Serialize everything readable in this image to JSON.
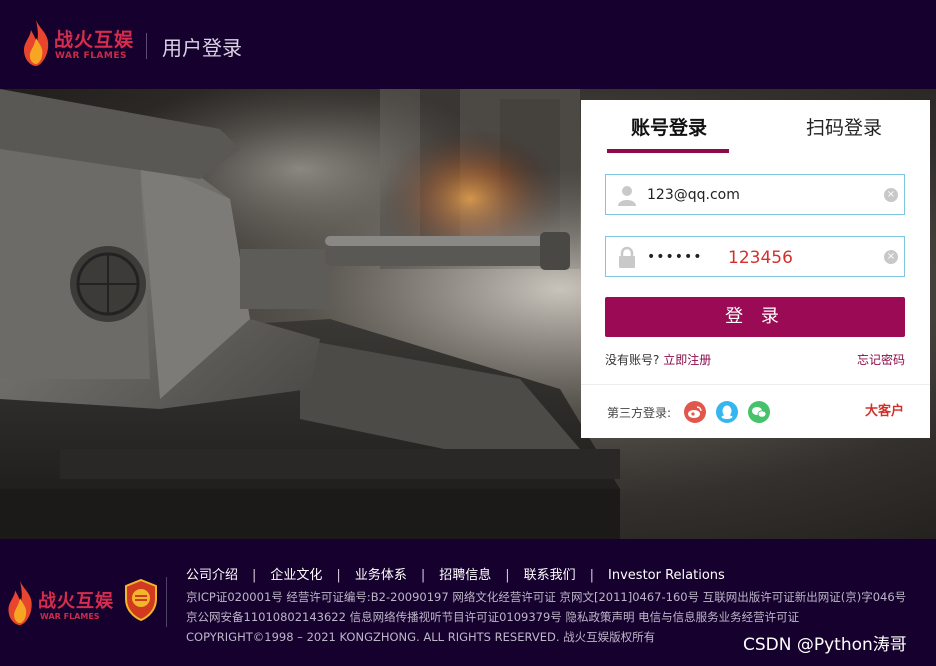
{
  "header": {
    "brand_cn": "战火互娱",
    "brand_en": "WAR FLAMES",
    "page_title": "用户登录"
  },
  "login": {
    "tabs": [
      {
        "label": "账号登录",
        "active": true
      },
      {
        "label": "扫码登录",
        "active": false
      }
    ],
    "username": {
      "value": "123@qq.com",
      "icon": "user-icon"
    },
    "password": {
      "masked_value": "••••••",
      "hint": "123456",
      "icon": "lock-icon"
    },
    "clear_glyph": "×",
    "submit_label": "登 录",
    "no_account_text": "没有账号?",
    "register_link": "立即注册",
    "forgot_link": "忘记密码",
    "third_party_label": "第三方登录:",
    "third_party": [
      "weibo-icon",
      "qq-icon",
      "wechat-icon"
    ],
    "vip_link": "大客户"
  },
  "footer": {
    "brand_cn": "战火互娱",
    "brand_en": "WAR FLAMES",
    "nav": [
      "公司介绍",
      "企业文化",
      "业务体系",
      "招聘信息",
      "联系我们",
      "Investor Relations"
    ],
    "nav_separator": "|",
    "line1": "京ICP证020001号   经营许可证编号:B2-20090197   网络文化经营许可证 京网文[2011]0467-160号   互联网出版许可证新出网证(京)字046号",
    "line2": "京公网安备11010802143622   信息网络传播视听节目许可证0109379号   隐私政策声明   电信与信息服务业务经营许可证",
    "line3": "COPYRIGHT©1998 – 2021 KONGZHONG. ALL RIGHTS RESERVED. 战火互娱版权所有",
    "watermark": "CSDN @Python涛哥"
  },
  "colors": {
    "page_bg": "#16002d",
    "accent": "#9b0b55",
    "tab_underline": "#8e0a4b",
    "input_border": "#7fc4e0",
    "hint_red": "#d4302b",
    "brand_red": "#d62d4f"
  }
}
